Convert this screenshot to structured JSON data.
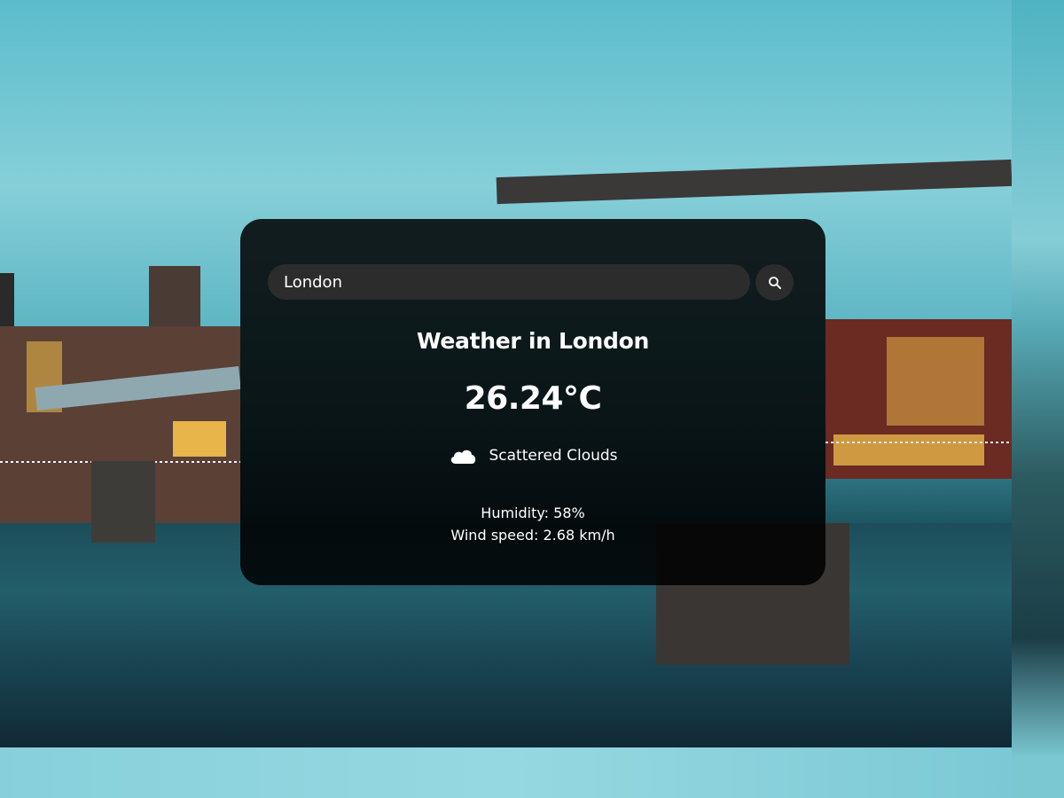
{
  "search": {
    "value": "London",
    "placeholder": "Search"
  },
  "weather": {
    "title": "Weather in London",
    "temperature": "26.24°C",
    "description": "Scattered Clouds",
    "icon": "cloud-icon",
    "humidity": "Humidity: 58%",
    "wind": "Wind speed: 2.68 km/h"
  },
  "background": {
    "scene": "city-bridge-photo"
  },
  "colors": {
    "card": "#000000",
    "input": "#2c2c2c",
    "text": "#ffffff"
  }
}
